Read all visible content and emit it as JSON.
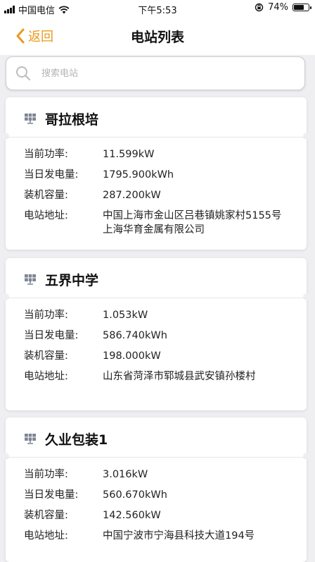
{
  "status_bar": {
    "carrier": "中国电信",
    "time": "下午5:53",
    "battery_percent": "74%",
    "battery_level": 0.74
  },
  "nav": {
    "back_label": "返回",
    "title": "电站列表"
  },
  "search": {
    "placeholder": "搜索电站",
    "value": ""
  },
  "labels": {
    "power": "当前功率:",
    "daily": "当日发电量:",
    "capacity": "装机容量:",
    "address": "电站地址:"
  },
  "stations": [
    {
      "name": "哥拉根培",
      "power": "11.599kW",
      "daily": "1795.900kWh",
      "capacity": "287.200kW",
      "address": "中国上海市金山区吕巷镇姚家村5155号上海华育金属有限公司"
    },
    {
      "name": "五界中学",
      "power": "1.053kW",
      "daily": "586.740kWh",
      "capacity": "198.000kW",
      "address": "山东省菏泽市郓城县武安镇孙楼村"
    },
    {
      "name": "久业包装1",
      "power": "3.016kW",
      "daily": "560.670kWh",
      "capacity": "142.560kW",
      "address": "中国宁波市宁海县科技大道194号"
    }
  ],
  "colors": {
    "accent": "#e99a1c",
    "background": "#efeff2"
  }
}
